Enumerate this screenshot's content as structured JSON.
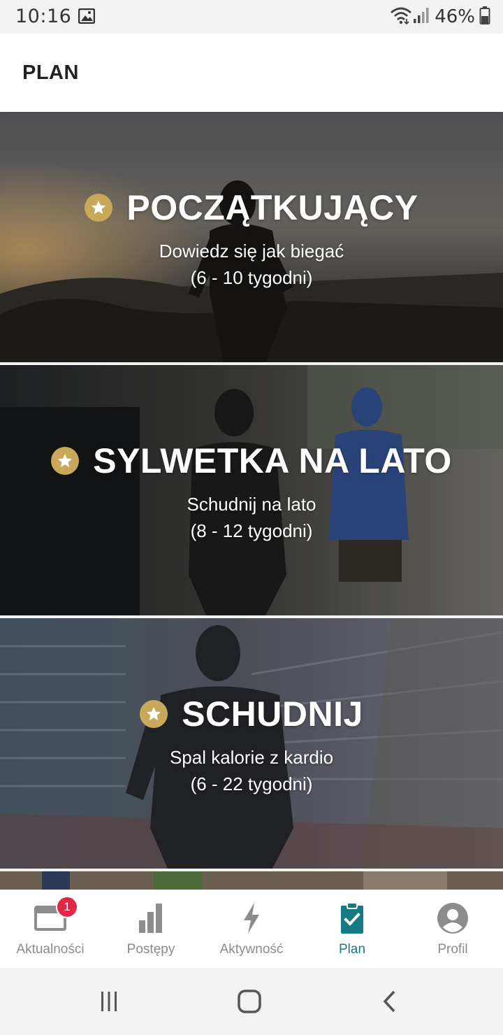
{
  "status_bar": {
    "time": "10:16",
    "battery": "46%",
    "icons": [
      "gallery-icon",
      "wifi-icon",
      "signal-icon",
      "battery-icon"
    ]
  },
  "header": {
    "title": "PLAN"
  },
  "plans": [
    {
      "title": "POCZĄTKUJĄCY",
      "subtitle": "Dowiedz się jak biegać",
      "duration": "(6 - 10 tygodni)"
    },
    {
      "title": "SYLWETKA NA LATO",
      "subtitle": "Schudnij na lato",
      "duration": "(8 - 12 tygodni)"
    },
    {
      "title": "SCHUDNIJ",
      "subtitle": "Spal kalorie z kardio",
      "duration": "(6 - 22 tygodni)"
    }
  ],
  "bottom_nav": {
    "items": [
      {
        "label": "Aktualności",
        "icon": "news-icon",
        "badge": "1"
      },
      {
        "label": "Postępy",
        "icon": "bar-chart-icon"
      },
      {
        "label": "Aktywność",
        "icon": "lightning-icon"
      },
      {
        "label": "Plan",
        "icon": "clipboard-check-icon",
        "active": true
      },
      {
        "label": "Profil",
        "icon": "profile-icon"
      }
    ]
  },
  "colors": {
    "accent": "#157a83",
    "star_gold": "#c9a85a",
    "badge_red": "#e0284a"
  }
}
